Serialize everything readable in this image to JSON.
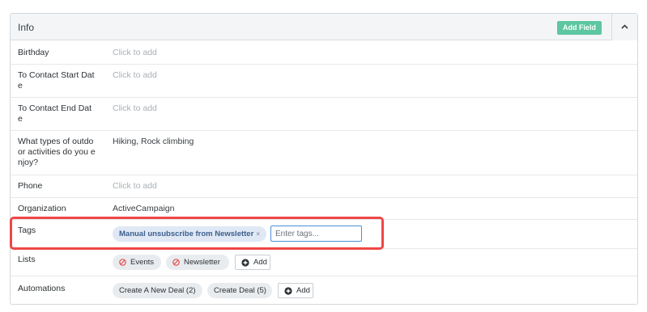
{
  "panel": {
    "title": "Info",
    "add_field_label": "Add Field",
    "collapse_icon": "chevron-up-icon"
  },
  "rows": {
    "birthday": {
      "label": "Birthday",
      "placeholder": "Click to add"
    },
    "to_contact_start": {
      "label": "To Contact Start Date",
      "placeholder": "Click to add"
    },
    "to_contact_end": {
      "label": "To Contact End Date",
      "placeholder": "Click to add"
    },
    "outdoor": {
      "label": "What types of outdoor activities do you enjoy?",
      "value": "Hiking, Rock climbing"
    },
    "phone": {
      "label": "Phone",
      "placeholder": "Click to add"
    },
    "organization": {
      "label": "Organization",
      "value": "ActiveCampaign"
    },
    "tags": {
      "label": "Tags",
      "items": [
        "Manual unsubscribe from Newsletter"
      ],
      "remove_glyph": "×",
      "input_placeholder": "Enter tags..."
    },
    "lists": {
      "label": "Lists",
      "items": [
        "Events",
        "Newsletter"
      ],
      "add_label": "Add"
    },
    "automations": {
      "label": "Automations",
      "items": [
        "Create A New Deal (2)",
        "Create Deal (5)"
      ],
      "add_label": "Add"
    }
  },
  "colors": {
    "add_field_button": "#5cc7a1",
    "highlight_box": "#f04646",
    "tag_pill_text": "#3d5f8f",
    "unsubscribed_icon": "#e24b4b"
  }
}
